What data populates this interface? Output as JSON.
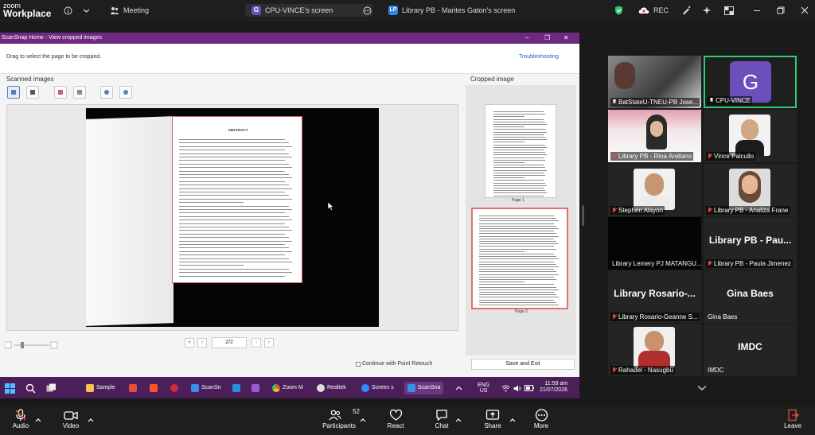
{
  "topbar": {
    "logo_line1": "zoom",
    "logo_line2": "Workplace",
    "meeting_label": "Meeting",
    "tab_active_badge": "G",
    "tab_active_label": "CPU-VINCE's screen",
    "tab2_badge": "LP",
    "tab2_label": "Library PB - Marites Gaton's screen",
    "rec_label": "REC"
  },
  "scansnap": {
    "window_title": "ScanSnap Home - View cropped images",
    "hint": "Drag to select the page to be cropped.",
    "troubleshooting": "Troubleshooting",
    "scanned_label": "Scanned images",
    "cropped_label": "Cropped image",
    "page_indicator": "2/2",
    "page1_label": "Page 1",
    "page2_label": "Page 2",
    "continue_label": "Continue with Point Retouch",
    "save_exit": "Save and Exit",
    "abstract_title": "ABSTRACT"
  },
  "taskbar": {
    "apps": [
      "Sample",
      "ScanSn",
      "Zoom M",
      "Realtek",
      "Screen s",
      "ScanSna"
    ],
    "lang_line1": "ENG",
    "lang_line2": "US",
    "time": "11:59 am",
    "date": "21/07/2026"
  },
  "participants": {
    "p1": "BatStateU-TNEU-PB Jose...",
    "p2": "CPU-VINCE",
    "p2_initial": "G",
    "p3": "Library PB - Rina Arellano",
    "p4": "Vince Palcullo",
    "p5": "Stephen Alayon",
    "p6": "Library PB - Analiza Frane",
    "p7": "Library Lemery PJ MATANGU...",
    "p8_big": "Library PB - Pau...",
    "p8": "Library PB - Paula Jimenez",
    "p9_big": "Library Rosario-...",
    "p9": "Library Rosario-Geanne S...",
    "p10_big": "Gina Baes",
    "p10": "Gina Baes",
    "p11": "Rahadel - Nasugbu",
    "p12_big": "IMDC",
    "p12": "IMDC"
  },
  "bottombar": {
    "audio": "Audio",
    "video": "Video",
    "participants": "Participants",
    "participants_count": "52",
    "react": "React",
    "chat": "Chat",
    "share": "Share",
    "more": "More",
    "leave": "Leave"
  },
  "colors": {
    "scansnap_title": "#6e2a82",
    "taskbar": "#4a1f5a",
    "active_speaker": "#2ecc71",
    "mute_red": "#e74c3c",
    "g_avatar": "#6b4fbb"
  }
}
